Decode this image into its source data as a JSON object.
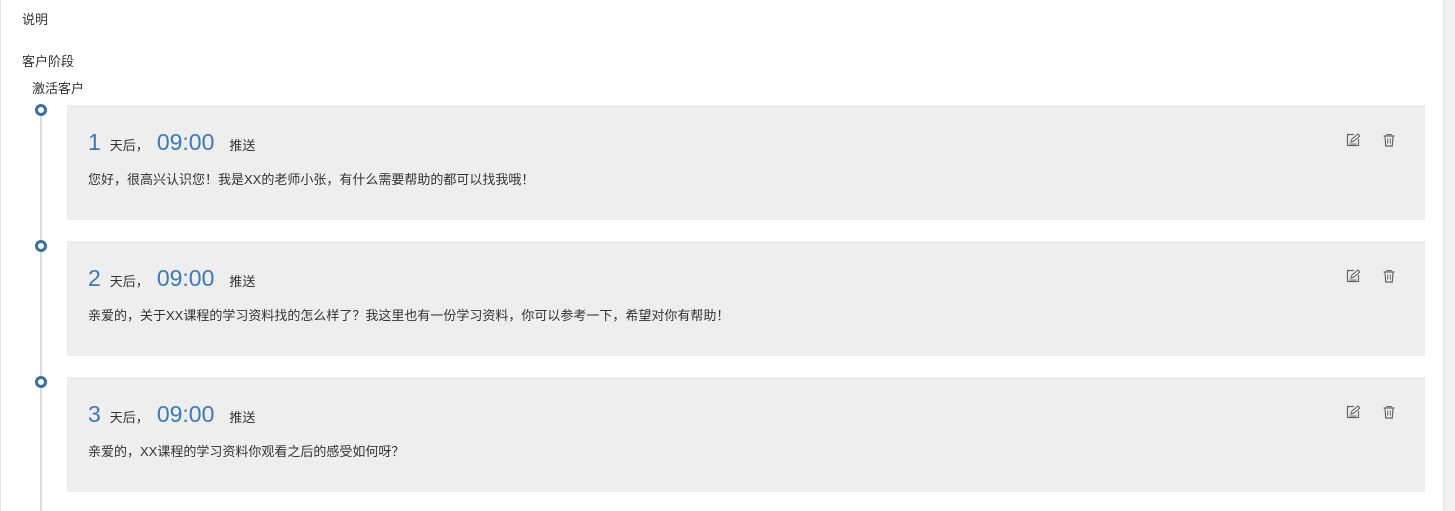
{
  "labels": {
    "description": "说明",
    "customer_stage": "客户阶段"
  },
  "stage": {
    "name": "激活客户",
    "steps": [
      {
        "day": "1",
        "day_suffix": "天后，",
        "time": "09:00",
        "action": "推送",
        "message": "您好，很高兴认识您！我是XX的老师小张，有什么需要帮助的都可以找我哦！"
      },
      {
        "day": "2",
        "day_suffix": "天后，",
        "time": "09:00",
        "action": "推送",
        "message": "亲爱的，关于XX课程的学习资料找的怎么样了？我这里也有一份学习资料，你可以参考一下，希望对你有帮助！"
      },
      {
        "day": "3",
        "day_suffix": "天后，",
        "time": "09:00",
        "action": "推送",
        "message": "亲爱的，XX课程的学习资料你观看之后的感受如何呀？"
      }
    ]
  },
  "icons": {
    "edit": "edit-icon",
    "delete": "trash-icon",
    "timeline_node": "circle-icon"
  },
  "colors": {
    "accent": "#3d79b6",
    "node": "#3a6ea6",
    "card_background": "#eeeeee",
    "timeline": "#dcdcdc",
    "text": "#333333",
    "icon": "#666666"
  }
}
